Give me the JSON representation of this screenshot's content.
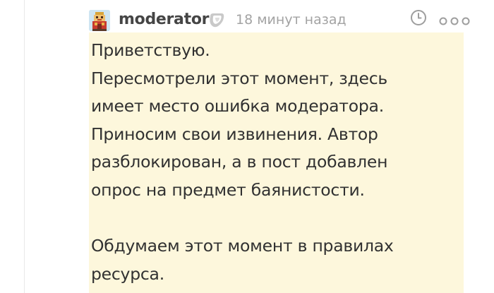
{
  "comment": {
    "author": "moderator",
    "time_ago": "18 минут назад",
    "paragraphs": [
      "Приветствую.\nПересмотрели этот момент, здесь\nимеет место ошибка модератора.\nПриносим свои извинения. Автор\nразблокирован, а в пост добавлен\nопрос на предмет баянистости.",
      "Обдумаем этот момент в правилах\nресурса."
    ]
  },
  "icons": {
    "avatar": "pixel-art-avatar",
    "badge": "moderator-badge-icon",
    "clock": "clock-icon",
    "more": "more-options-icon"
  },
  "colors": {
    "comment_highlight": "#fdf7dc",
    "username": "#454545",
    "timestamp": "#a3a3a3",
    "text": "#313131"
  }
}
